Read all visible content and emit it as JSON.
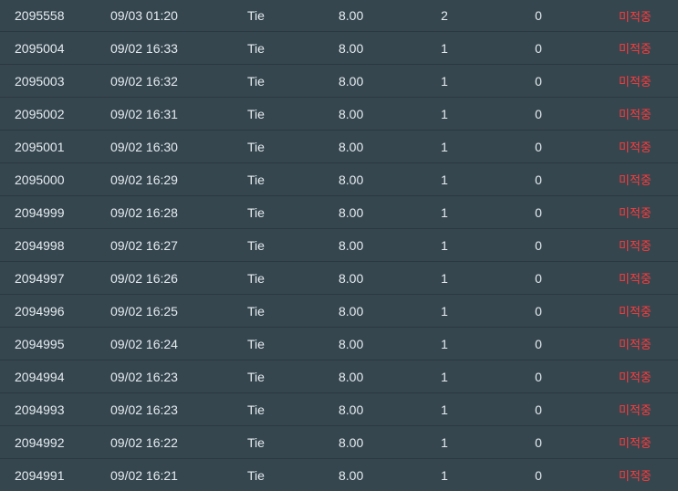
{
  "rows": [
    {
      "id": "2095558",
      "time": "09/03 01:20",
      "bet": "Tie",
      "odds": "8.00",
      "count": "2",
      "win": "0",
      "status": "미적중"
    },
    {
      "id": "2095004",
      "time": "09/02 16:33",
      "bet": "Tie",
      "odds": "8.00",
      "count": "1",
      "win": "0",
      "status": "미적중"
    },
    {
      "id": "2095003",
      "time": "09/02 16:32",
      "bet": "Tie",
      "odds": "8.00",
      "count": "1",
      "win": "0",
      "status": "미적중"
    },
    {
      "id": "2095002",
      "time": "09/02 16:31",
      "bet": "Tie",
      "odds": "8.00",
      "count": "1",
      "win": "0",
      "status": "미적중"
    },
    {
      "id": "2095001",
      "time": "09/02 16:30",
      "bet": "Tie",
      "odds": "8.00",
      "count": "1",
      "win": "0",
      "status": "미적중"
    },
    {
      "id": "2095000",
      "time": "09/02 16:29",
      "bet": "Tie",
      "odds": "8.00",
      "count": "1",
      "win": "0",
      "status": "미적중"
    },
    {
      "id": "2094999",
      "time": "09/02 16:28",
      "bet": "Tie",
      "odds": "8.00",
      "count": "1",
      "win": "0",
      "status": "미적중"
    },
    {
      "id": "2094998",
      "time": "09/02 16:27",
      "bet": "Tie",
      "odds": "8.00",
      "count": "1",
      "win": "0",
      "status": "미적중"
    },
    {
      "id": "2094997",
      "time": "09/02 16:26",
      "bet": "Tie",
      "odds": "8.00",
      "count": "1",
      "win": "0",
      "status": "미적중"
    },
    {
      "id": "2094996",
      "time": "09/02 16:25",
      "bet": "Tie",
      "odds": "8.00",
      "count": "1",
      "win": "0",
      "status": "미적중"
    },
    {
      "id": "2094995",
      "time": "09/02 16:24",
      "bet": "Tie",
      "odds": "8.00",
      "count": "1",
      "win": "0",
      "status": "미적중"
    },
    {
      "id": "2094994",
      "time": "09/02 16:23",
      "bet": "Tie",
      "odds": "8.00",
      "count": "1",
      "win": "0",
      "status": "미적중"
    },
    {
      "id": "2094993",
      "time": "09/02 16:23",
      "bet": "Tie",
      "odds": "8.00",
      "count": "1",
      "win": "0",
      "status": "미적중"
    },
    {
      "id": "2094992",
      "time": "09/02 16:22",
      "bet": "Tie",
      "odds": "8.00",
      "count": "1",
      "win": "0",
      "status": "미적중"
    },
    {
      "id": "2094991",
      "time": "09/02 16:21",
      "bet": "Tie",
      "odds": "8.00",
      "count": "1",
      "win": "0",
      "status": "미적중"
    }
  ],
  "colors": {
    "row_background": "#35464f",
    "row_divider": "#2a3841",
    "text": "#e6ecef",
    "status_red": "#ff3b3b"
  }
}
